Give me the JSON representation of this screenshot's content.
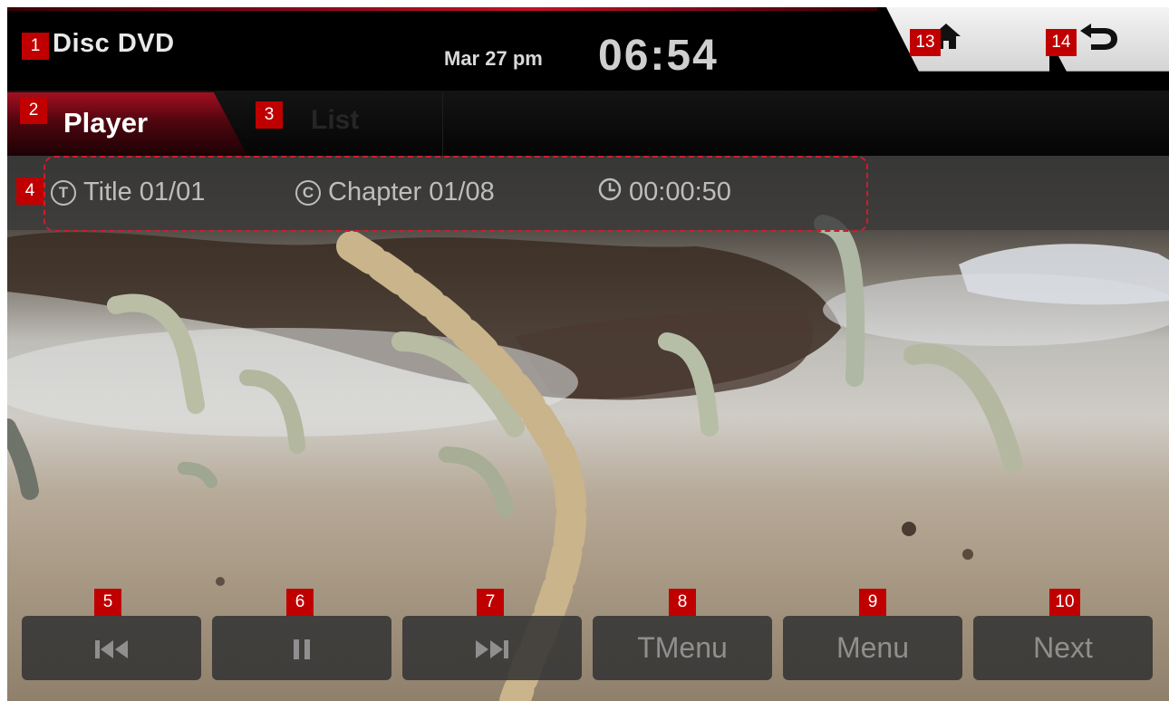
{
  "header": {
    "title": "Disc DVD",
    "date": "Mar 27 pm",
    "time": "06:54"
  },
  "tabs": [
    {
      "label": "Player",
      "active": true
    },
    {
      "label": "List",
      "active": false
    }
  ],
  "info": {
    "title_icon": "T",
    "title": "Title 01/01",
    "chapter_icon": "C",
    "chapter": "Chapter 01/08",
    "elapsed": "00:00:50"
  },
  "controls": {
    "prev_icon": "previous-track-icon",
    "pause_icon": "pause-icon",
    "next_track_icon": "next-track-icon",
    "tmenu": "TMenu",
    "menu": "Menu",
    "next": "Next"
  },
  "nav": {
    "home_icon": "home-icon",
    "back_icon": "back-icon"
  },
  "badges": {
    "b1": "1",
    "b2": "2",
    "b3": "3",
    "b4": "4",
    "b5": "5",
    "b6": "6",
    "b7": "7",
    "b8": "8",
    "b9": "9",
    "b10": "10",
    "b13": "13",
    "b14": "14"
  },
  "colors": {
    "accent": "#a30f21",
    "badge": "#c00000",
    "highlight": "#d11b2b"
  }
}
